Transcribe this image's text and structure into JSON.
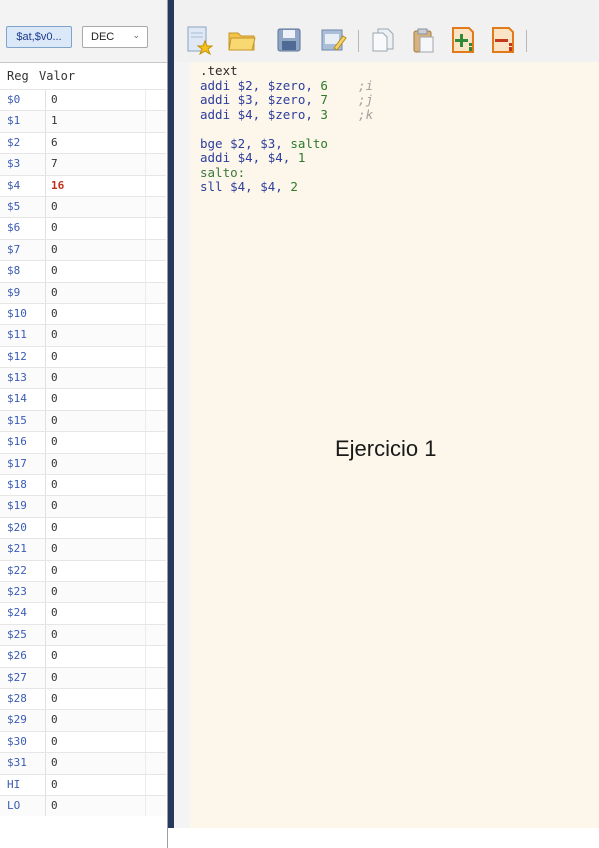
{
  "register_panel": {
    "alias_button": "$at,$v0...",
    "base_select": {
      "selected": "DEC"
    },
    "headers": {
      "reg": "Reg",
      "value": "Valor"
    },
    "rows": [
      {
        "name": "$0",
        "value": "0"
      },
      {
        "name": "$1",
        "value": "1"
      },
      {
        "name": "$2",
        "value": "6"
      },
      {
        "name": "$3",
        "value": "7"
      },
      {
        "name": "$4",
        "value": "16",
        "changed": true
      },
      {
        "name": "$5",
        "value": "0"
      },
      {
        "name": "$6",
        "value": "0"
      },
      {
        "name": "$7",
        "value": "0"
      },
      {
        "name": "$8",
        "value": "0"
      },
      {
        "name": "$9",
        "value": "0"
      },
      {
        "name": "$10",
        "value": "0"
      },
      {
        "name": "$11",
        "value": "0"
      },
      {
        "name": "$12",
        "value": "0"
      },
      {
        "name": "$13",
        "value": "0"
      },
      {
        "name": "$14",
        "value": "0"
      },
      {
        "name": "$15",
        "value": "0"
      },
      {
        "name": "$16",
        "value": "0"
      },
      {
        "name": "$17",
        "value": "0"
      },
      {
        "name": "$18",
        "value": "0"
      },
      {
        "name": "$19",
        "value": "0"
      },
      {
        "name": "$20",
        "value": "0"
      },
      {
        "name": "$21",
        "value": "0"
      },
      {
        "name": "$22",
        "value": "0"
      },
      {
        "name": "$23",
        "value": "0"
      },
      {
        "name": "$24",
        "value": "0"
      },
      {
        "name": "$25",
        "value": "0"
      },
      {
        "name": "$26",
        "value": "0"
      },
      {
        "name": "$27",
        "value": "0"
      },
      {
        "name": "$28",
        "value": "0"
      },
      {
        "name": "$29",
        "value": "0"
      },
      {
        "name": "$30",
        "value": "0"
      },
      {
        "name": "$31",
        "value": "0"
      },
      {
        "name": "HI",
        "value": "0"
      },
      {
        "name": "LO",
        "value": "0"
      }
    ]
  },
  "toolbar": {
    "icons": [
      "new-file-icon",
      "open-folder-icon",
      "save-icon",
      "edit-icon",
      "copy-icon",
      "paste-icon",
      "add-breakpoint-icon",
      "remove-breakpoint-icon"
    ]
  },
  "editor": {
    "lines": [
      {
        "parts": [
          {
            "t": ".text",
            "c": "c-dir"
          }
        ]
      },
      {
        "parts": [
          {
            "t": "addi $2, $zero, ",
            "c": "c-kw"
          },
          {
            "t": "6",
            "c": "c-num"
          },
          {
            "t": "    ;i",
            "c": "c-cmt"
          }
        ]
      },
      {
        "parts": [
          {
            "t": "addi $3, $zero, ",
            "c": "c-kw"
          },
          {
            "t": "7",
            "c": "c-num"
          },
          {
            "t": "    ;j",
            "c": "c-cmt"
          }
        ]
      },
      {
        "parts": [
          {
            "t": "addi $4, $zero, ",
            "c": "c-kw"
          },
          {
            "t": "3",
            "c": "c-num"
          },
          {
            "t": "    ;k",
            "c": "c-cmt"
          }
        ]
      },
      {
        "parts": [
          {
            "t": "",
            "c": "c-kw"
          }
        ]
      },
      {
        "parts": [
          {
            "t": "bge $2, $3, ",
            "c": "c-kw"
          },
          {
            "t": "salto",
            "c": "c-lbl-use"
          }
        ]
      },
      {
        "parts": [
          {
            "t": "addi $4, $4, ",
            "c": "c-kw"
          },
          {
            "t": "1",
            "c": "c-num"
          }
        ]
      },
      {
        "parts": [
          {
            "t": "salto:",
            "c": "c-lbl"
          }
        ]
      },
      {
        "parts": [
          {
            "t": "sll $4, $4, ",
            "c": "c-kw"
          },
          {
            "t": "2",
            "c": "c-num"
          }
        ]
      }
    ],
    "overlay_title": "Ejercicio 1"
  },
  "colors": {
    "register_name": "#3a5bb5",
    "changed_value": "#c0311a",
    "editor_bg": "#fdf6ea",
    "divider": "#26395d"
  }
}
